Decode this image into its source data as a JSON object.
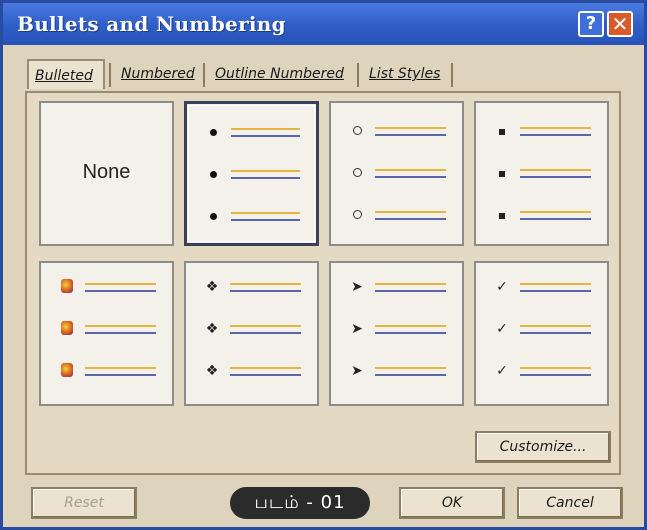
{
  "dialog": {
    "title": "Bullets and Numbering"
  },
  "title_buttons": {
    "help": "?",
    "close": "✕"
  },
  "tabs": [
    {
      "label": "Bulleted",
      "active": true
    },
    {
      "label": "Numbered",
      "active": false
    },
    {
      "label": "Outline Numbered",
      "active": false
    },
    {
      "label": "List Styles",
      "active": false
    }
  ],
  "gallery": {
    "none_label": "None",
    "bullet_styles": [
      {
        "id": "none",
        "icon": "none"
      },
      {
        "id": "filled-dot",
        "icon": "filled-circle-bullet",
        "selected": true
      },
      {
        "id": "hollow-circle",
        "icon": "hollow-circle-bullet"
      },
      {
        "id": "square",
        "icon": "square-bullet"
      },
      {
        "id": "picture",
        "icon": "picture-bullet"
      },
      {
        "id": "diamonds",
        "icon": "four-diamond-bullet",
        "glyph": "❖"
      },
      {
        "id": "arrowhead",
        "icon": "arrowhead-bullet",
        "glyph": "➤"
      },
      {
        "id": "checkmark",
        "icon": "checkmark-bullet",
        "glyph": "✓"
      }
    ]
  },
  "buttons": {
    "customize": "Customize...",
    "reset": "Reset",
    "ok": "OK",
    "cancel": "Cancel"
  },
  "caption": "படம் - 01",
  "colors": {
    "titlebar": "#2f5fc8",
    "close_button": "#d85a2a",
    "dialog_bg": "#ded3bd"
  }
}
